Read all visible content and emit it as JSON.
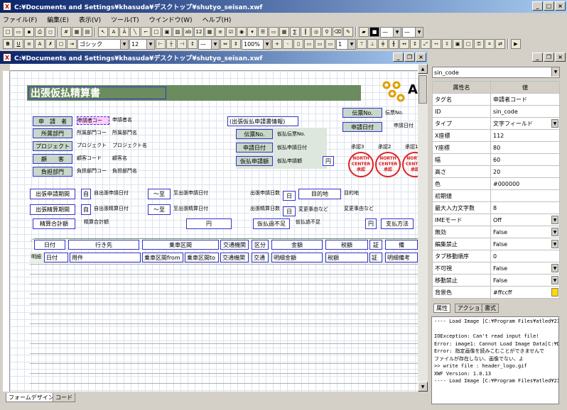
{
  "app": {
    "title": "C:¥Documents and Settings¥khasuda¥デスクトップ¥shutyo_seisan.xwf"
  },
  "menu": [
    "ファイル(F)",
    "編集(E)",
    "表示(V)",
    "ツール(T)",
    "ウインドウ(W)",
    "ヘルプ(H)"
  ],
  "toolbar": {
    "font": "ゴシック",
    "size": "12",
    "zoom": "100%",
    "line_width": "1"
  },
  "child": {
    "title": "C:¥Documents and Settings¥khasuda¥デスクトップ¥shutyo_seisan.xwf"
  },
  "form": {
    "title": "出張仮払精算書",
    "logo_letter": "A",
    "left_labels": [
      "申　請　者",
      "所属部門",
      "プロジェクト",
      "顧　　客",
      "負担部門"
    ],
    "left_fields": [
      [
        "申請者コー",
        "申請者名"
      ],
      [
        "所属部門コー",
        "所属部門名"
      ],
      [
        "プロジェクト",
        "プロジェクト名"
      ],
      [
        "顧客コード",
        "顧客名"
      ],
      [
        "負担部門コー",
        "負担部門名"
      ]
    ],
    "info_header": "(出張仮払申請書情報)",
    "info_labels": [
      "伝票No.",
      "申請日付",
      "仮払申請額"
    ],
    "info_fields": [
      "仮払伝票No.",
      "仮払申請日付",
      "仮払申請額"
    ],
    "yen": "円",
    "right_labels": [
      "伝票No.",
      "申請日付"
    ],
    "right_texts": [
      "伝票No.",
      "申請日付"
    ],
    "approvals": [
      "承認3",
      "承認2",
      "承認1"
    ],
    "stamp": [
      "NORTH",
      "CENTER",
      "承認"
    ],
    "period_rows": [
      {
        "label": "出張申請期間",
        "start": "自出張申請日付",
        "mid": "～至",
        "end": "至出張申請日付",
        "days": "出張申請日数",
        "days_lbl": "出張申請日数"
      },
      {
        "label": "出張精算期間",
        "start": "自出張精算日付",
        "mid": "～至",
        "end": "至出張精算日付",
        "days": "出張精算日数",
        "days_lbl": "出張精算日数"
      }
    ],
    "day_unit": "日",
    "self_char": "自",
    "purpose_lbl": "目的地",
    "purpose_val": "目的地",
    "change_lbl": "変更事由など",
    "change_val": "変更事由など",
    "total_lbl": "精算合計額",
    "total_val": "精算合計額",
    "short_lbl": "仮払過不足",
    "short_val": "仮払過不足",
    "pay_lbl": "支払方法",
    "columns": [
      "日付",
      "行き先",
      "乗車区間",
      "交通機関",
      "区分",
      "金額",
      "税額",
      "証",
      "備"
    ],
    "detail": [
      "明細",
      "日付",
      "用件",
      "乗車区間from",
      "",
      "乗車区間to",
      "交通機関",
      "交通",
      "明細金額",
      "税額",
      "証",
      "明細備考"
    ]
  },
  "tabs_bottom": [
    "フォームデザイン",
    "コード"
  ],
  "panel": {
    "object": "sin_code",
    "head_key": "属性名",
    "head_val": "値",
    "props": [
      [
        "タグ名",
        "申請者コード"
      ],
      [
        "ID",
        "sin_code"
      ],
      [
        "タイプ",
        "文字フィールド"
      ],
      [
        "X座標",
        "112"
      ],
      [
        "Y座標",
        "80"
      ],
      [
        "幅",
        "60"
      ],
      [
        "高さ",
        "20"
      ],
      [
        "色",
        "#000000"
      ],
      [
        "初期値",
        ""
      ],
      [
        "最大入力文字数",
        "8"
      ],
      [
        "IMEモード",
        "Off"
      ],
      [
        "無効",
        "False"
      ],
      [
        "編集禁止",
        "False"
      ],
      [
        "タブ移動順序",
        "0"
      ],
      [
        "不可視",
        "False"
      ],
      [
        "移動禁止",
        "False"
      ],
      [
        "背景色",
        "#ffccff"
      ]
    ],
    "tabs": [
      "属性",
      "アクション",
      "書式"
    ],
    "log": [
      "---- Load Image [C:¥Program Files¥atled¥21",
      "",
      "IOException: Can't read input file!",
      "Error: image1: Cannot Load Image Data[C:¥Do",
      "Error: 指定画像を読みこむことができませんで",
      "        ファイルが存在しない、画像でない、よ",
      ">> write file : header_logo.gif",
      "XWF Version: 1.0.13",
      "---- Load Image [C:¥Program Files¥atled¥21"
    ]
  }
}
